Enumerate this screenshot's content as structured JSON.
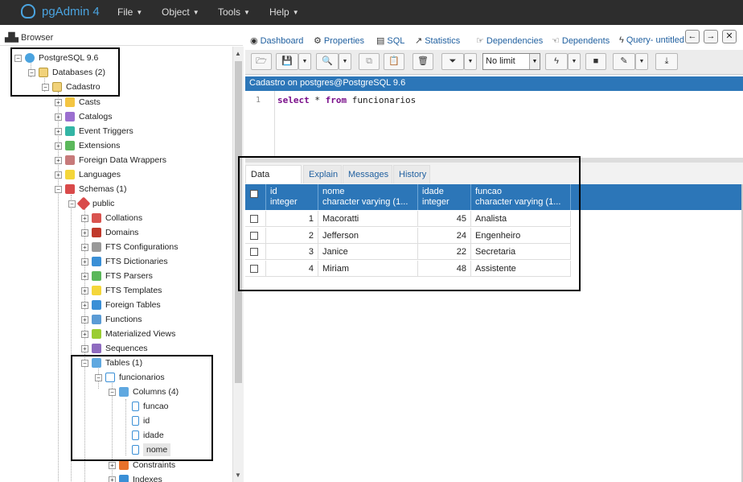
{
  "app": {
    "name": "pgAdmin 4"
  },
  "menu": [
    "File",
    "Object",
    "Tools",
    "Help"
  ],
  "browser": {
    "title": "Browser",
    "tree": [
      "PostgreSQL 9.6",
      "Databases (2)",
      "Cadastro",
      "Casts",
      "Catalogs",
      "Event Triggers",
      "Extensions",
      "Foreign Data Wrappers",
      "Languages",
      "Schemas (1)",
      "public",
      "Collations",
      "Domains",
      "FTS Configurations",
      "FTS Dictionaries",
      "FTS Parsers",
      "FTS Templates",
      "Foreign Tables",
      "Functions",
      "Materialized Views",
      "Sequences",
      "Tables (1)",
      "funcionarios",
      "Columns (4)",
      "funcao",
      "id",
      "idade",
      "nome",
      "Constraints",
      "Indexes"
    ]
  },
  "tabs": [
    "Dashboard",
    "Properties",
    "SQL",
    "Statistics",
    "Dependencies",
    "Dependents",
    "Query- untitled"
  ],
  "nav_buttons": [
    "←",
    "→",
    "✕"
  ],
  "toolbar": {
    "limit": "No limit"
  },
  "connection": "Cadastro on postgres@PostgreSQL 9.6",
  "editor": {
    "line_number": "1",
    "tokens": [
      {
        "t": "select",
        "kw": true
      },
      {
        "t": " * ",
        "kw": false
      },
      {
        "t": "from",
        "kw": true
      },
      {
        "t": " funcionarios",
        "kw": false
      }
    ]
  },
  "output": {
    "tabs": [
      "Data Output",
      "Explain",
      "Messages",
      "History"
    ],
    "columns": [
      {
        "name": "id",
        "type": "integer"
      },
      {
        "name": "nome",
        "type": "character varying (1..."
      },
      {
        "name": "idade",
        "type": "integer"
      },
      {
        "name": "funcao",
        "type": "character varying (1..."
      }
    ],
    "rows": [
      [
        "1",
        "Macoratti",
        "45",
        "Analista"
      ],
      [
        "2",
        "Jefferson",
        "24",
        "Engenheiro"
      ],
      [
        "3",
        "Janice",
        "22",
        "Secretaria"
      ],
      [
        "4",
        "Miriam",
        "48",
        "Assistente"
      ]
    ]
  },
  "colors": {
    "navbar": "#2d2d2d",
    "accent": "#2c76b8",
    "brand": "#4aa3df"
  }
}
